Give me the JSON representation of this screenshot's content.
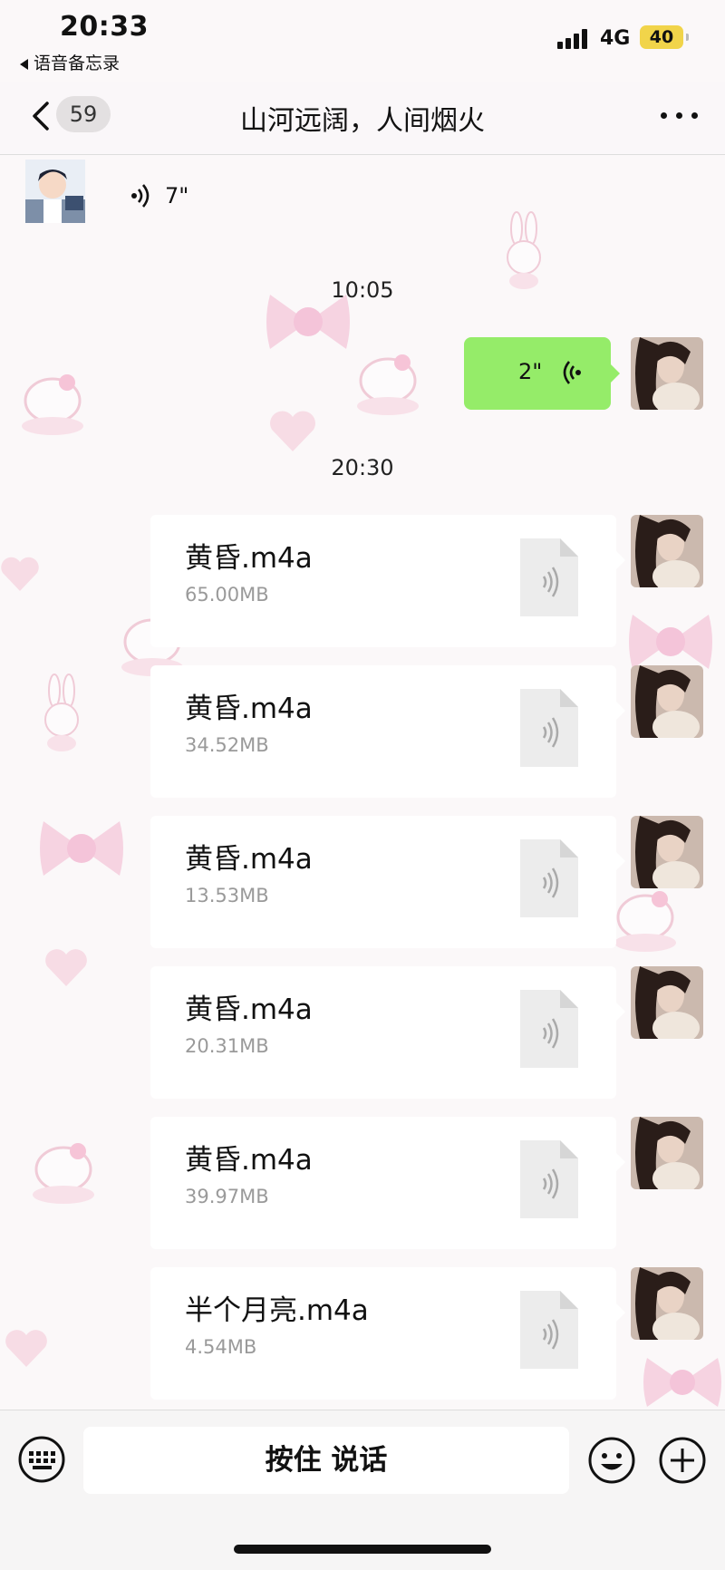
{
  "status_bar": {
    "time": "20:33",
    "back_app": "语音备忘录",
    "network": "4G",
    "battery": "40"
  },
  "nav": {
    "unread_count": "59",
    "title": "山河远阔，人间烟火"
  },
  "messages": {
    "voice_in": {
      "duration": "7\""
    },
    "timestamp_1": "10:05",
    "voice_out": {
      "duration": "2\""
    },
    "timestamp_2": "20:30",
    "files": [
      {
        "name": "黄昏.m4a",
        "size": "65.00MB"
      },
      {
        "name": "黄昏.m4a",
        "size": "34.52MB"
      },
      {
        "name": "黄昏.m4a",
        "size": "13.53MB"
      },
      {
        "name": "黄昏.m4a",
        "size": "20.31MB"
      },
      {
        "name": "黄昏.m4a",
        "size": "39.97MB"
      },
      {
        "name": "半个月亮.m4a",
        "size": "4.54MB"
      }
    ]
  },
  "input_bar": {
    "talk_label": "按住 说话"
  },
  "colors": {
    "sent_bubble": "#95ec69",
    "battery": "#f1d44a"
  }
}
